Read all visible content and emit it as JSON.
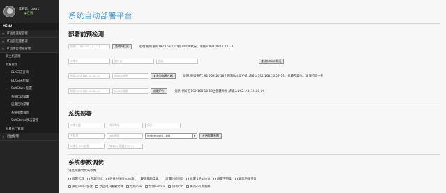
{
  "sidebar": {
    "user": {
      "greeting": "欢迎您：user1",
      "status": "●在线"
    },
    "menu_title": "MENU",
    "items": [
      {
        "label": "IT运维流程管理",
        "icon": "layers-icon"
      },
      {
        "label": "IT运营配置管理",
        "icon": "layers-icon"
      },
      {
        "label": "IT运维自动化管理",
        "icon": "refresh-icon",
        "expanded": true
      }
    ],
    "sub_items": [
      {
        "label": "云主机管理"
      },
      {
        "label": "批量管理"
      },
      {
        "label": "ELK日志查询",
        "icon": "chevron-right-icon"
      },
      {
        "label": "ELK日志配置",
        "icon": "chevron-right-icon"
      },
      {
        "label": "SaltStack 配置",
        "icon": "chevron-right-icon"
      },
      {
        "label": "系统自动部署",
        "icon": "chevron-right-icon"
      },
      {
        "label": "应用自动部署",
        "icon": "chevron-right-icon"
      },
      {
        "label": "系统参数调优",
        "icon": "chevron-right-icon"
      },
      {
        "label": "SaltStatus状态管理",
        "icon": "chevron-right-icon"
      },
      {
        "label": "批量执行管理"
      }
    ],
    "footer_item": {
      "label": "后台管理",
      "icon": "gear-icon"
    }
  },
  "main": {
    "title": "系统自动部署平台",
    "precheck": {
      "title": "部署前预检测",
      "row1": {
        "input_placeholder": "例如：192.168.10.1-21",
        "button": "查询IP状况",
        "note": "说明:例如查询192.168.10.1到20的IP状况，请输入192.168.10.1-21"
      },
      "row2": {
        "input1_placeholder": "IP地址",
        "input2_placeholder": "用户名",
        "input3_placeholder": "密码",
        "button": "查询kernel状况"
      },
      "row3": {
        "input_placeholder": "例如:192.168.10.18-19",
        "input2_placeholder": "SaltID前缀",
        "button": "安装Salt客户端",
        "note": "说明:例如要在192.168.10.18上部署Salt客户端,请输入192.168.10.18-19。批量部署时，请保持同一密"
      },
      "row4": {
        "input_placeholder": "例如:192.168.10.18-19",
        "input2_placeholder": "SaltID前缀",
        "button": "创建IP列",
        "note": "说明:例如在192.168.10.18上创建网桥,请输入192.168.10.18-19"
      }
    },
    "deploy": {
      "title": "系统部署",
      "row1": {
        "input1_placeholder": "IP地址段",
        "input2_placeholder": "子网掩码",
        "input3_placeholder": "网关"
      },
      "row2": {
        "input1_placeholder": "主机名",
        "input2_placeholder": "root密码",
        "select_value": "vmtemplate1.tdg",
        "button": "开始部署系统"
      },
      "row3": {
        "input1_placeholder": "IP地址 CPU核数",
        "input2_placeholder": "内存(G) 硬盘大小(G)"
      }
    },
    "tuning": {
      "title": "系统参数调优",
      "hint": "请选择要调优的参数",
      "options_row1": [
        "设置代理",
        "部署YNC",
        "更换为国内yum源",
        "安装辅助工具",
        "设置时间同步",
        "设置文件ulimit",
        "设置字符集",
        "调优内核参数"
      ],
      "options_row2": [
        "调优ulimit会话",
        "禁止用户重要文件",
        "禁用ipv6",
        "禁用selinux",
        "调优ssh",
        "关闭不常用服务"
      ]
    }
  }
}
